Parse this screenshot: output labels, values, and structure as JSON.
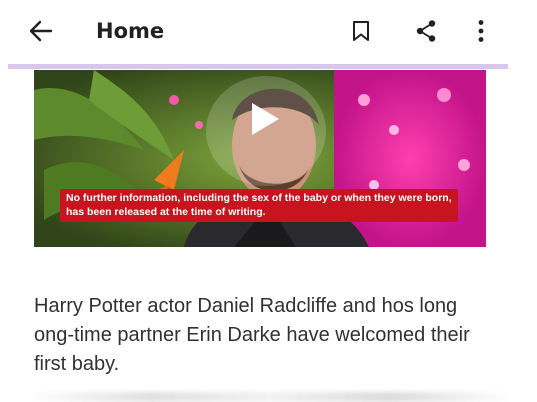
{
  "header": {
    "title": "Home",
    "back_icon": "arrow-left-icon",
    "bookmark_icon": "bookmark-icon",
    "share_icon": "share-icon",
    "more_icon": "more-vert-icon"
  },
  "colors": {
    "accent_line": "#d9c6ec",
    "caption_bg": "#c8141e",
    "play_icon": "#ffffff"
  },
  "video": {
    "play_icon": "play-icon",
    "caption_line1": "No further information, including the sex of the baby or when they were born,",
    "caption_line2": "has been released at the time of writing."
  },
  "article": {
    "body_line1": "Harry Potter actor Daniel Radcliffe and hos long",
    "body_line2": "ong-time partner Erin Darke have welcomed their",
    "body_line3": "first baby."
  }
}
